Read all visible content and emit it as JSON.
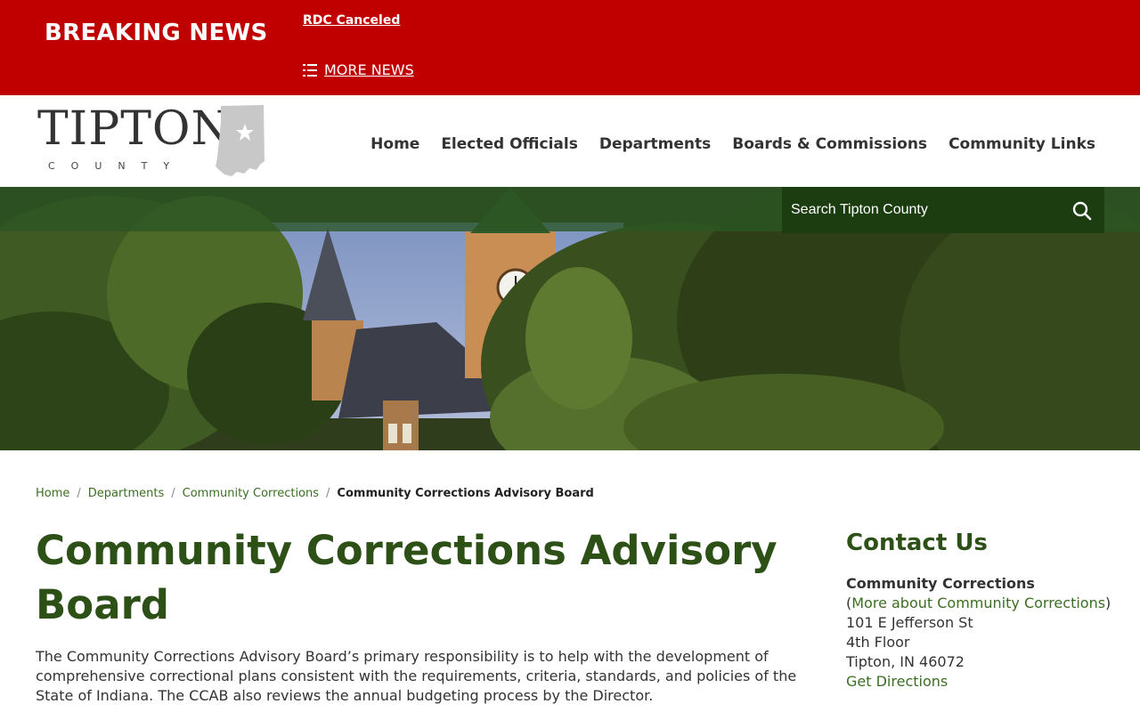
{
  "breaking_news": {
    "label": "BREAKING NEWS",
    "headline": "RDC Canceled",
    "more_label": "MORE NEWS"
  },
  "header": {
    "logo_word": "TIPTON",
    "logo_sub": "COUNTY",
    "nav": [
      "Home",
      "Elected Officials",
      "Departments",
      "Boards & Commissions",
      "Community Links"
    ]
  },
  "search": {
    "placeholder": "Search Tipton County"
  },
  "breadcrumb": {
    "items": [
      "Home",
      "Departments",
      "Community Corrections"
    ],
    "separator": "/",
    "current": "Community Corrections Advisory Board"
  },
  "page": {
    "title": "Community Corrections Advisory Board",
    "description": "The Community Corrections Advisory Board’s primary responsibility is to help with the development of comprehensive correctional plans consistent with the requirements, criteria, standards, and policies of the State of Indiana. The CCAB also reviews the annual budgeting process by the Director."
  },
  "contact": {
    "heading": "Contact Us",
    "name": "Community Corrections",
    "more_link": "More about Community Corrections",
    "address1": "101 E Jefferson St",
    "address2": "4th Floor",
    "city": "Tipton, IN 46072",
    "directions": "Get Directions"
  },
  "colors": {
    "breaking_red": "#c00000",
    "brand_green": "#2d5016",
    "link_green": "#3b6e22",
    "search_bg": "#1b3d10"
  },
  "icons": {
    "more_news": "list-icon",
    "search": "search-icon",
    "logo_state": "indiana-state-icon"
  }
}
